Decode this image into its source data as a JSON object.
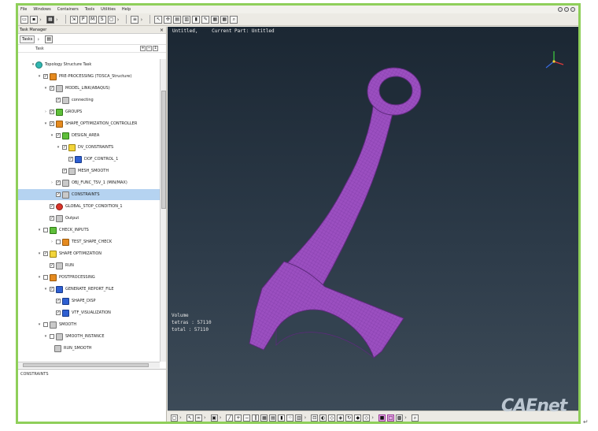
{
  "menu": [
    "File",
    "Windows",
    "Containers",
    "Tools",
    "Utilities",
    "Help"
  ],
  "task_manager": {
    "title": "Task Manager",
    "close_label": "×",
    "tools_tab": "Tasks",
    "column_header": "Task"
  },
  "tree": [
    {
      "label": "Topology Structure Task",
      "indent": 2,
      "icon": "root",
      "twisty": "▾",
      "checked": false,
      "check": false
    },
    {
      "label": "PRE-PROCESSING (TOSCA_Structure)",
      "indent": 3,
      "icon": "orange",
      "twisty": "▾",
      "checked": true,
      "check": true
    },
    {
      "label": "MODEL_LINK(ABAQUS)",
      "indent": 4,
      "icon": "gray",
      "twisty": "▾",
      "checked": true,
      "check": true
    },
    {
      "label": "connecting",
      "indent": 5,
      "icon": "gray",
      "twisty": "",
      "checked": true,
      "check": true
    },
    {
      "label": "GROUPS",
      "indent": 4,
      "icon": "green",
      "twisty": "›",
      "checked": true,
      "check": true
    },
    {
      "label": "SHAPE_OPTIMIZATION_CONTROLLER",
      "indent": 4,
      "icon": "orange",
      "twisty": "▾",
      "checked": true,
      "check": true
    },
    {
      "label": "DESIGN_AREA",
      "indent": 5,
      "icon": "green",
      "twisty": "▾",
      "checked": true,
      "check": true
    },
    {
      "label": "DV_CONSTRAINTS",
      "indent": 6,
      "icon": "yellow",
      "twisty": "▾",
      "checked": true,
      "check": true
    },
    {
      "label": "DOF_CONTROL_1",
      "indent": 7,
      "icon": "blue",
      "twisty": "",
      "checked": true,
      "check": true
    },
    {
      "label": "MESH_SMOOTH",
      "indent": 6,
      "icon": "gray",
      "twisty": "",
      "checked": true,
      "check": true
    },
    {
      "label": "OBJ_FUNC_TSV_1 (MIN/MAX)",
      "indent": 5,
      "icon": "gray",
      "twisty": "›",
      "checked": true,
      "check": true
    },
    {
      "label": "CONSTRAINTS",
      "indent": 5,
      "icon": "gray",
      "twisty": "",
      "checked": true,
      "check": true,
      "selected": true
    },
    {
      "label": "GLOBAL_STOP_CONDITION_1",
      "indent": 4,
      "icon": "red",
      "twisty": "",
      "checked": true,
      "check": true
    },
    {
      "label": "Output",
      "indent": 4,
      "icon": "gray",
      "twisty": "",
      "checked": true,
      "check": true
    },
    {
      "label": "CHECK_INPUTS",
      "indent": 3,
      "icon": "green",
      "twisty": "▾",
      "checked": false,
      "check": true
    },
    {
      "label": "TEST_SHAPE_CHECK",
      "indent": 5,
      "icon": "orange",
      "twisty": "›",
      "checked": false,
      "check": true
    },
    {
      "label": "SHAPE OPTIMIZATION",
      "indent": 3,
      "icon": "yellow",
      "twisty": "▾",
      "checked": true,
      "check": true
    },
    {
      "label": "RUN",
      "indent": 4,
      "icon": "gray",
      "twisty": "",
      "checked": true,
      "check": true
    },
    {
      "label": "POSTPROCESSING",
      "indent": 3,
      "icon": "orange",
      "twisty": "▾",
      "checked": false,
      "check": true
    },
    {
      "label": "GENERATE_REPORT_FILE",
      "indent": 4,
      "icon": "blue",
      "twisty": "▾",
      "checked": true,
      "check": true
    },
    {
      "label": "SHAPE_DISP",
      "indent": 5,
      "icon": "blue",
      "twisty": "",
      "checked": true,
      "check": true
    },
    {
      "label": "VTF_VISUALIZATION",
      "indent": 5,
      "icon": "blue",
      "twisty": "",
      "checked": true,
      "check": true
    },
    {
      "label": "SMOOTH",
      "indent": 3,
      "icon": "gray",
      "twisty": "▾",
      "checked": false,
      "check": true
    },
    {
      "label": "SMOOTH_INSTANCE",
      "indent": 4,
      "icon": "gray",
      "twisty": "▾",
      "checked": false,
      "check": true
    },
    {
      "label": "RUN_SMOOTH",
      "indent": 5,
      "icon": "gray",
      "twisty": "",
      "checked": false,
      "check": false
    }
  ],
  "status_text": "CONSTRAINTS",
  "viewport": {
    "header_left": "Untitled,",
    "header_right": "Current Part: Untitled",
    "stats_title": "Volume",
    "stats_tetras": "tetras :  57110",
    "stats_total": "total  :  57110"
  },
  "watermark": "CAEnet",
  "return_glyph": "↵",
  "colors": {
    "frame_border": "#8fcf5a",
    "mesh": "#9b4fc0",
    "mesh_line": "#6d2f92",
    "selection": "#b5d3f1",
    "viewport_top": "#1b2733"
  }
}
